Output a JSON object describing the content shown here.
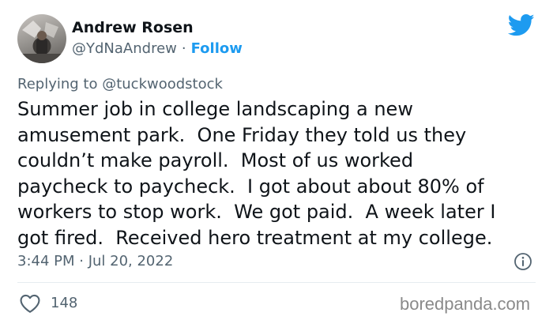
{
  "author": {
    "name": "Andrew Rosen",
    "handle": "@YdNaAndrew",
    "separator": "·",
    "follow_label": "Follow"
  },
  "reply": {
    "prefix": "Replying to ",
    "mention": "@tuckwoodstock"
  },
  "tweet": {
    "lines": [
      "Summer job in college landscaping a new",
      "amusement park.  One Friday they told us they",
      "couldn’t make payroll.  Most of us worked",
      "paycheck to paycheck.  I got about about 80% of",
      "workers to stop work.  We got paid.  A week later I",
      "got fired.  Received hero treatment at my college."
    ]
  },
  "meta": {
    "timestamp": "3:44 PM · Jul 20, 2022"
  },
  "engagement": {
    "likes": "148"
  },
  "watermark": "boredpanda.com",
  "icons": {
    "brand": "twitter-bird-icon",
    "info": "info-icon",
    "like": "heart-icon"
  },
  "colors": {
    "accent": "#1d9bf0",
    "muted": "#536471",
    "text": "#0f1419"
  }
}
